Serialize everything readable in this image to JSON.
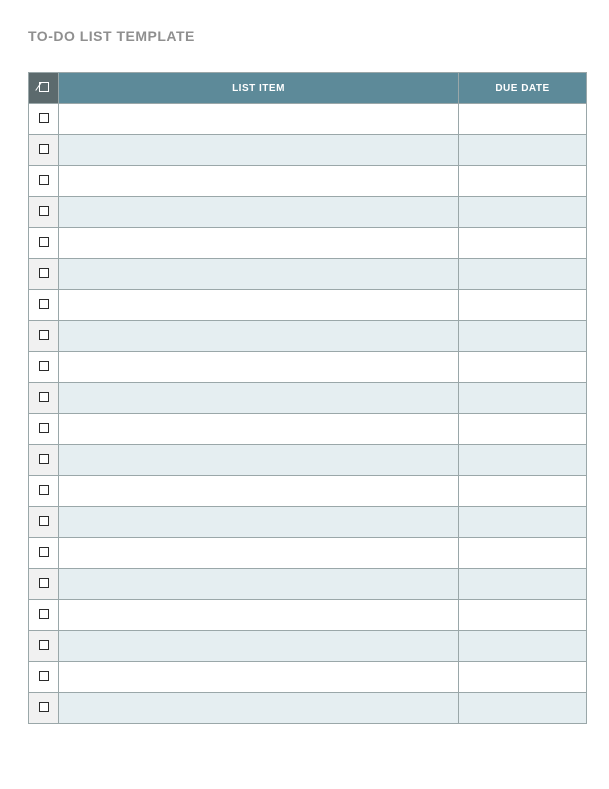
{
  "title": "TO-DO LIST TEMPLATE",
  "headers": {
    "check": "☑",
    "item": "LIST ITEM",
    "due": "DUE DATE"
  },
  "rows": [
    {
      "checked": false,
      "item": "",
      "due": ""
    },
    {
      "checked": false,
      "item": "",
      "due": ""
    },
    {
      "checked": false,
      "item": "",
      "due": ""
    },
    {
      "checked": false,
      "item": "",
      "due": ""
    },
    {
      "checked": false,
      "item": "",
      "due": ""
    },
    {
      "checked": false,
      "item": "",
      "due": ""
    },
    {
      "checked": false,
      "item": "",
      "due": ""
    },
    {
      "checked": false,
      "item": "",
      "due": ""
    },
    {
      "checked": false,
      "item": "",
      "due": ""
    },
    {
      "checked": false,
      "item": "",
      "due": ""
    },
    {
      "checked": false,
      "item": "",
      "due": ""
    },
    {
      "checked": false,
      "item": "",
      "due": ""
    },
    {
      "checked": false,
      "item": "",
      "due": ""
    },
    {
      "checked": false,
      "item": "",
      "due": ""
    },
    {
      "checked": false,
      "item": "",
      "due": ""
    },
    {
      "checked": false,
      "item": "",
      "due": ""
    },
    {
      "checked": false,
      "item": "",
      "due": ""
    },
    {
      "checked": false,
      "item": "",
      "due": ""
    },
    {
      "checked": false,
      "item": "",
      "due": ""
    },
    {
      "checked": false,
      "item": "",
      "due": ""
    }
  ]
}
